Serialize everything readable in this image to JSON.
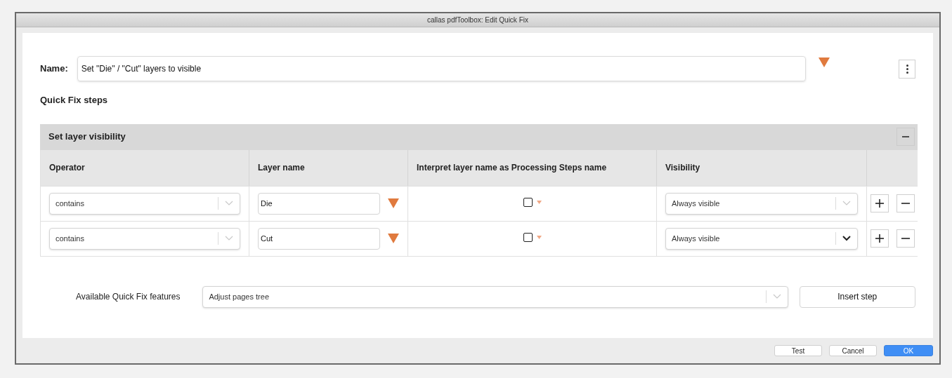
{
  "window": {
    "title": "callas pdfToolbox: Edit Quick Fix"
  },
  "name_field": {
    "label": "Name:",
    "value": "Set \"Die\" / \"Cut\" layers to visible"
  },
  "steps_heading": "Quick Fix steps",
  "step": {
    "title": "Set layer visibility",
    "expanded": true,
    "columns": [
      "Operator",
      "Layer name",
      "Interpret layer name as Processing Steps name",
      "Visibility"
    ],
    "rows": [
      {
        "operator": "contains",
        "layer_name": "Die",
        "interpret": false,
        "visibility": "Always visible",
        "visibility_focused": false
      },
      {
        "operator": "contains",
        "layer_name": "Cut",
        "interpret": false,
        "visibility": "Always visible",
        "visibility_focused": true
      }
    ]
  },
  "features": {
    "label": "Available Quick Fix features",
    "value": "Adjust pages tree",
    "button": "Insert step"
  },
  "footer_buttons": [
    {
      "label": "Test",
      "primary": false
    },
    {
      "label": "Cancel",
      "primary": false
    },
    {
      "label": "OK",
      "primary": true
    }
  ]
}
